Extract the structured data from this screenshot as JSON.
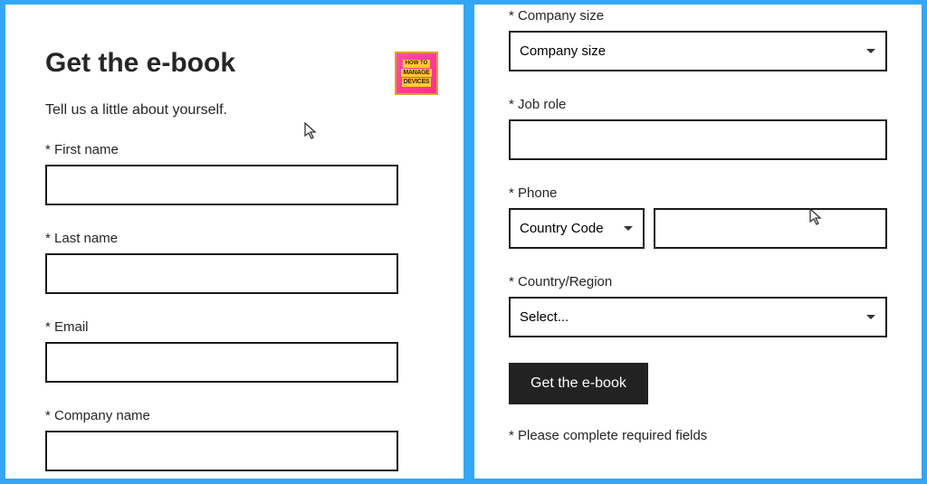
{
  "left": {
    "title": "Get the e-book",
    "subtitle": "Tell us a little about yourself.",
    "badge_line1": "HOW TO",
    "badge_line2": "MANAGE",
    "badge_line3": "DEVICES",
    "fields": {
      "first_name": {
        "label": "* First name",
        "value": ""
      },
      "last_name": {
        "label": "* Last name",
        "value": ""
      },
      "email": {
        "label": "* Email",
        "value": ""
      },
      "company": {
        "label": "* Company name",
        "value": ""
      }
    }
  },
  "right": {
    "fields": {
      "company_size": {
        "label": "* Company size",
        "selected": "Company size"
      },
      "job_role": {
        "label": "* Job role",
        "value": ""
      },
      "phone": {
        "label": "* Phone",
        "country_code_selected": "Country Code",
        "value": ""
      },
      "country": {
        "label": "* Country/Region",
        "selected": "Select..."
      }
    },
    "submit_label": "Get the e-book",
    "footnote": "* Please complete required fields"
  }
}
